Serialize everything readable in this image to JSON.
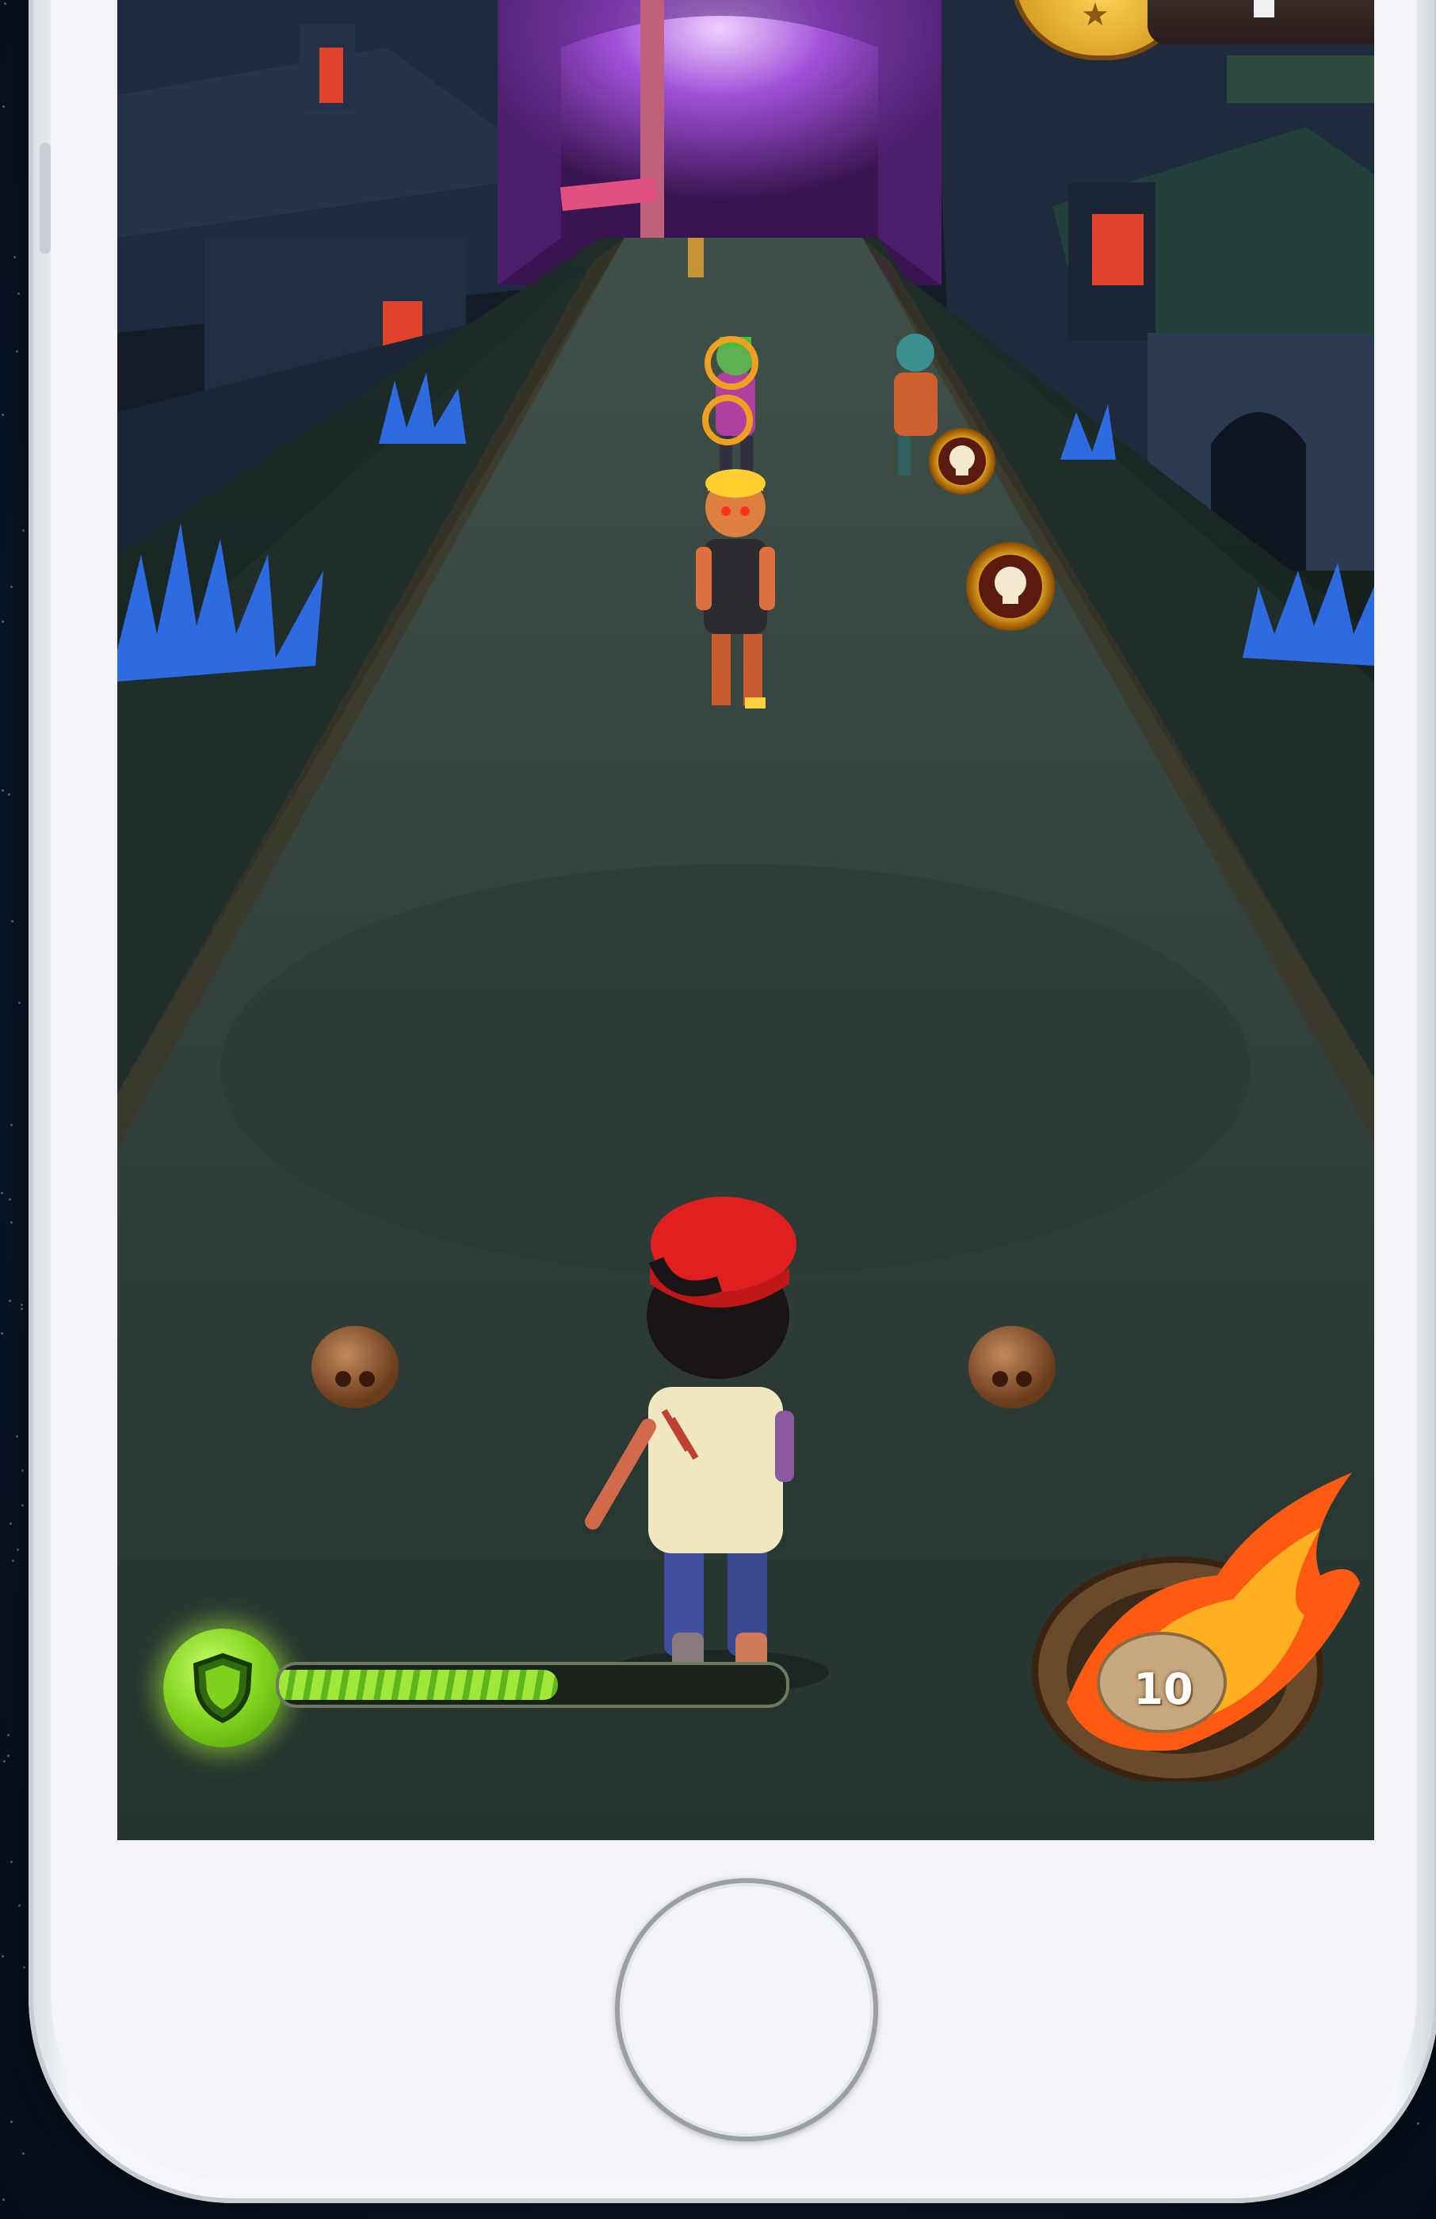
{
  "hud": {
    "shield_icon": "shield-icon",
    "shield_progress": 0.55,
    "fireball_count": "10",
    "fireball_icon": "fireball-icon",
    "coin_icon": "coin-icon"
  },
  "device": {
    "home_button": "home-button"
  },
  "colors": {
    "shield_green": "#7fd21e",
    "road": "#2b3a34",
    "fire": "#ff7a1a",
    "cap_red": "#e02020"
  }
}
